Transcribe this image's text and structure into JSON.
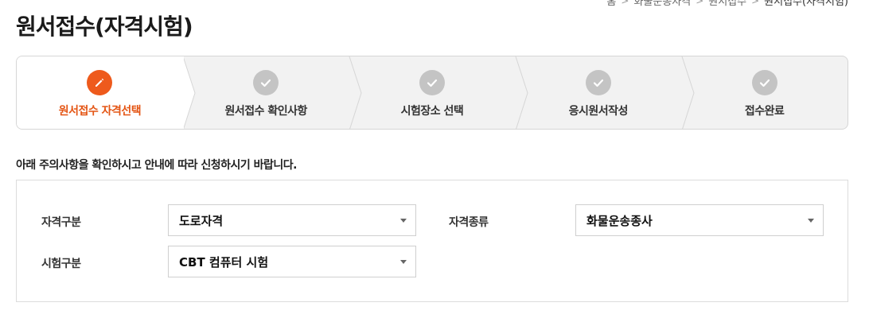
{
  "breadcrumb": {
    "items": [
      "홈",
      "화물운송자격",
      "원서접수",
      "원서접수(자격시험)"
    ]
  },
  "page": {
    "title": "원서접수(자격시험)"
  },
  "steps": [
    {
      "label": "원서접수 자격선택",
      "state": "active",
      "icon": "pencil-icon"
    },
    {
      "label": "원서접수 확인사항",
      "state": "inactive",
      "icon": "check-icon"
    },
    {
      "label": "시험장소 선택",
      "state": "inactive",
      "icon": "check-icon"
    },
    {
      "label": "응시원서작성",
      "state": "inactive",
      "icon": "check-icon"
    },
    {
      "label": "접수완료",
      "state": "inactive",
      "icon": "check-icon"
    }
  ],
  "notice": "아래 주의사항을 확인하시고 안내에 따라 신청하시기 바랍니다.",
  "form": {
    "qualification_type": {
      "label": "자격구분",
      "value": "도로자격"
    },
    "qualification_kind": {
      "label": "자격종류",
      "value": "화물운송종사"
    },
    "exam_type": {
      "label": "시험구분",
      "value": "CBT 컴퓨터 시험"
    }
  },
  "colors": {
    "accent": "#ee5a1c",
    "inactive_circle": "#c4c4c4",
    "steps_bg": "#f2f2f2"
  }
}
